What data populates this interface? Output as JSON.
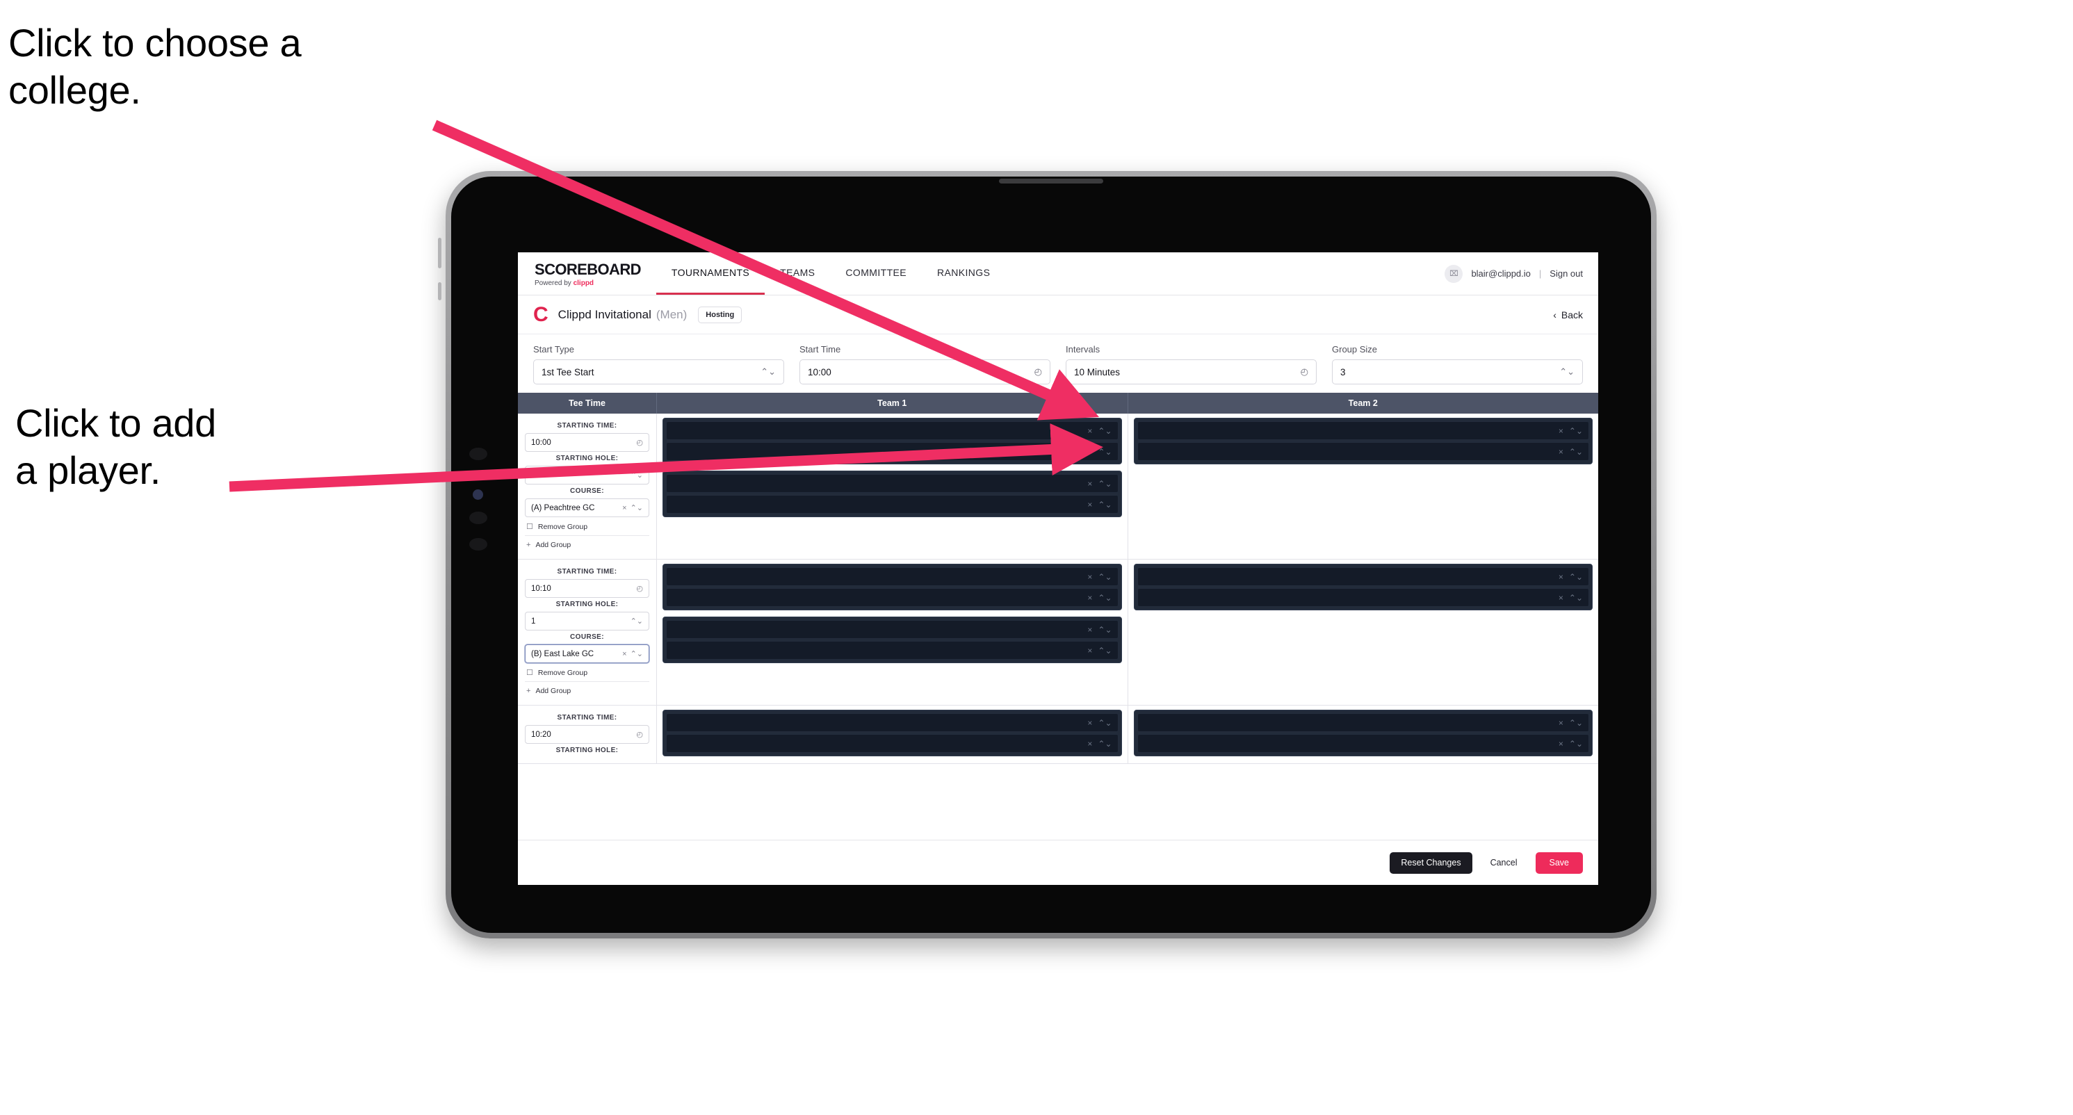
{
  "annotations": [
    {
      "id": "choose-college",
      "text": "Click to choose a\ncollege."
    },
    {
      "id": "add-player",
      "text": "Click to add\na player."
    }
  ],
  "colors": {
    "accent_pink": "#ee2b5b",
    "arrow_pink": "#ef2e63",
    "table_header": "#4d5467",
    "group_card": "#222b3a",
    "player_row": "#141b28",
    "reset_button": "#1b1b22"
  },
  "topnav": {
    "brand_main": "SCOREBOARD",
    "brand_sub_prefix": "Powered by",
    "brand_sub_name": "clippd",
    "tabs": [
      {
        "label": "TOURNAMENTS",
        "active": true
      },
      {
        "label": "TEAMS",
        "active": false
      },
      {
        "label": "COMMITTEE",
        "active": false
      },
      {
        "label": "RANKINGS",
        "active": false
      }
    ],
    "avatar_glyph": "⌧",
    "user_email": "blair@clippd.io",
    "separator": "|",
    "sign_out": "Sign out"
  },
  "tournament_bar": {
    "logo_letter": "C",
    "title": "Clippd Invitational",
    "gender": "(Men)",
    "badge": "Hosting",
    "back_chevron": "‹",
    "back_label": "Back"
  },
  "settings": [
    {
      "label": "Start Type",
      "value": "1st Tee Start",
      "icon": "stepper-icon",
      "glyph": "⌃⌄"
    },
    {
      "label": "Start Time",
      "value": "10:00",
      "icon": "clock-icon",
      "glyph": "◴"
    },
    {
      "label": "Intervals",
      "value": "10 Minutes",
      "icon": "clock-icon",
      "glyph": "◴"
    },
    {
      "label": "Group Size",
      "value": "3",
      "icon": "stepper-icon",
      "glyph": "⌃⌄"
    }
  ],
  "table": {
    "columns": [
      {
        "key": "tee",
        "label": "Tee Time"
      },
      {
        "key": "team1",
        "label": "Team 1"
      },
      {
        "key": "team2",
        "label": "Team 2"
      }
    ],
    "field_labels": {
      "starting_time": "STARTING TIME:",
      "starting_hole": "STARTING HOLE:",
      "course": "COURSE:"
    },
    "group_actions": {
      "remove": "Remove Group",
      "remove_icon": "trash-icon",
      "remove_glyph": "☐",
      "add": "Add Group",
      "add_icon": "plus-icon",
      "add_glyph": "+"
    },
    "row_icons": {
      "clear_glyph": "×",
      "stepper_glyph": "⌃⌄",
      "clock_glyph": "◴"
    },
    "rows": [
      {
        "starting_time": "10:00",
        "starting_hole": "1",
        "course": "(A) Peachtree GC",
        "course_focused": false,
        "truncated": false,
        "team1_groups": [
          {
            "players": [
              "",
              ""
            ]
          },
          {
            "players": [
              "",
              ""
            ]
          }
        ],
        "team2_groups": [
          {
            "players": [
              "",
              ""
            ]
          }
        ]
      },
      {
        "starting_time": "10:10",
        "starting_hole": "1",
        "course": "(B) East Lake GC",
        "course_focused": true,
        "truncated": false,
        "team1_groups": [
          {
            "players": [
              "",
              ""
            ]
          },
          {
            "players": [
              "",
              ""
            ]
          }
        ],
        "team2_groups": [
          {
            "players": [
              "",
              ""
            ]
          }
        ]
      },
      {
        "starting_time": "10:20",
        "starting_hole": "",
        "course": "",
        "course_focused": false,
        "truncated": true,
        "team1_groups": [
          {
            "players": [
              "",
              ""
            ]
          }
        ],
        "team2_groups": [
          {
            "players": [
              "",
              ""
            ]
          }
        ]
      }
    ]
  },
  "footer": {
    "reset_label": "Reset Changes",
    "cancel_label": "Cancel",
    "save_label": "Save"
  }
}
